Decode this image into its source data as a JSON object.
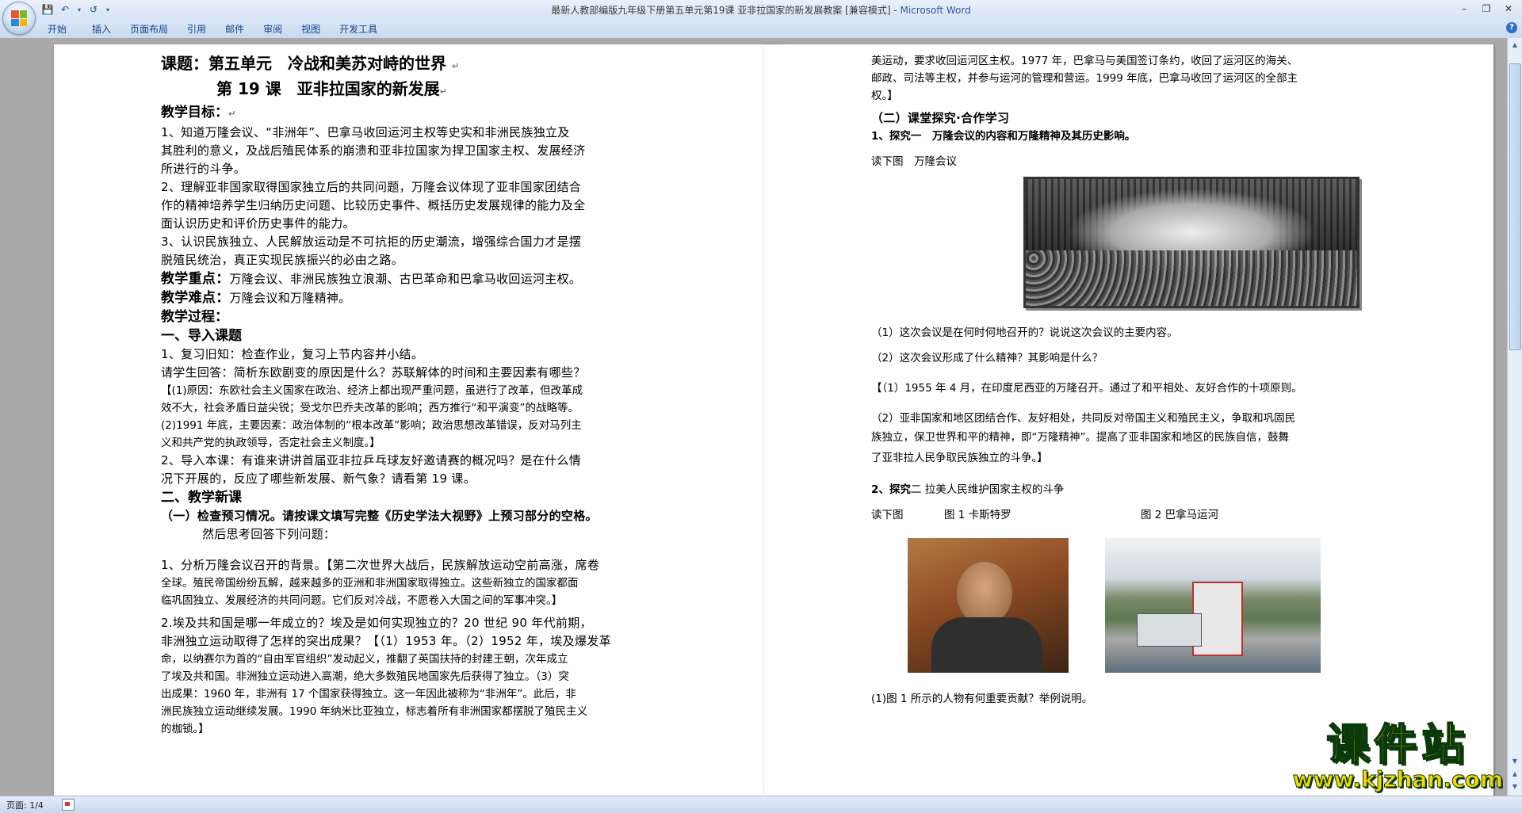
{
  "window": {
    "title": "最新人教部编版九年级下册第五单元第19课 亚非拉国家的新发展教案 [兼容模式] - ",
    "app_name": "Microsoft Word"
  },
  "ribbon": {
    "tabs": [
      "开始",
      "插入",
      "页面布局",
      "引用",
      "邮件",
      "审阅",
      "视图",
      "开发工具"
    ]
  },
  "status": {
    "page_counter": "页面: 1/4"
  },
  "watermark": {
    "title": "课件站",
    "url": "www.kjzhan.com"
  },
  "left_page": {
    "title1": "课题：第五单元　冷战和美苏对峙的世界",
    "title2": "第 19 课　亚非拉国家的新发展",
    "goals_head": "教学目标：",
    "goal1": [
      "1、知道万隆会议、“非洲年”、巴拿马收回运河主权等史实和非洲民族独立及",
      "其胜利的意义，及战后殖民体系的崩溃和亚非拉国家为捍卫国家主权、发展经济",
      "所进行的斗争。"
    ],
    "goal2": [
      "2、理解亚非国家取得国家独立后的共同问题，万隆会议体现了亚非国家团结合",
      "作的精神培养学生归纳历史问题、比较历史事件、概括历史发展规律的能力及全",
      "面认识历史和评价历史事件的能力。"
    ],
    "goal3": [
      "3、认识民族独立、人民解放运动是不可抗拒的历史潮流，增强综合国力才是摆",
      "脱殖民统治，真正实现民族振兴的必由之路。"
    ],
    "key_head": "教学重点：",
    "key_text": "万隆会议、非洲民族独立浪潮、古巴革命和巴拿马收回运河主权。",
    "diff_head": "教学难点：",
    "diff_text": "万隆会议和万隆精神。",
    "process_head": "教学过程：",
    "sec1_head": "一、导入课题",
    "review1": "1、复习旧知：检查作业，复习上节内容并小结。",
    "review2": "请学生回答：简析东欧剧变的原因是什么？苏联解体的时间和主要因素有哪些？",
    "answer_lines": [
      "【(1)原因：东欧社会主义国家在政治、经济上都出现严重问题，虽进行了改革，但改革成",
      "效不大，社会矛盾日益尖锐；受戈尔巴乔夫改革的影响；西方推行“和平演变”的战略等。",
      "(2)1991 年底，主要因素：政治体制的“根本改革”影响；政治思想改革错误，反对马列主",
      "义和共产党的执政领导，否定社会主义制度。】"
    ],
    "intro_lines": [
      "2、导入本课：有谁来讲讲首届亚非拉乒乓球友好邀请赛的概况吗？是在什么情",
      "况下开展的，反应了哪些新发展、新气象？请看第 19 课。"
    ],
    "sec2_head": "二、教学新课",
    "preview_lines": [
      "（一）检查预习情况。请按课文填写完整《历史学法大视野》上预习部分的空格。",
      "然后思考回答下列问题："
    ],
    "q1_lines": [
      "1、分析万隆会议召开的背景。【第二次世界大战后，民族解放运动空前高涨，席卷",
      "全球。殖民帝国纷纷瓦解，越来越多的亚洲和非洲国家取得独立。这些新独立的国家都面",
      "临巩固独立、发展经济的共同问题。它们反对冷战，不愿卷入大国之间的军事冲突。】"
    ],
    "q2_lines": [
      "2.埃及共和国是哪一年成立的？埃及是如何实现独立的？20 世纪 90 年代前期，",
      "非洲独立运动取得了怎样的突出成果？【（1）1953 年。（2）1952 年，埃及爆发革",
      "命，以纳赛尔为首的“自由军官组织”发动起义，推翻了英国扶持的封建王朝，次年成立",
      "了埃及共和国。非洲独立运动进入高潮，绝大多数殖民地国家先后获得了独立。（3）突",
      "出成果：1960 年，非洲有 17 个国家获得独立。这一年因此被称为“非洲年”。此后，非",
      "洲民族独立运动继续发展。1990 年纳米比亚独立，标志着所有非洲国家都摆脱了殖民主义",
      "的枷锁。】"
    ]
  },
  "right_page": {
    "top_lines": [
      "美运动，要求收回运河区主权。1977 年，巴拿马与美国签订条约，收回了运河区的海关、",
      "邮政、司法等主权，并参与运河的管理和营运。1999 年底，巴拿马收回了运河区的全部主",
      "权。】"
    ],
    "explore_head": "（二）课堂探究·合作学习",
    "explore1": "1、探究一　万隆会议的内容和万隆精神及其历史影响。",
    "read_fig1": "读下图　万隆会议",
    "q_a": "（1）这次会议是在何时何地召开的？说说这次会议的主要内容。",
    "q_b": "（2）这次会议形成了什么精神？其影响是什么？",
    "ans_a": "【（1）1955 年 4 月，在印度尼西亚的万隆召开。通过了和平相处、友好合作的十项原则。",
    "ans_b_lines": [
      "（2）亚非国家和地区团结合作、友好相处，共同反对帝国主义和殖民主义，争取和巩固民",
      "族独立，保卫世界和平的精神，即“万隆精神”。提高了亚非国家和地区的民族自信，鼓舞",
      "了亚非拉人民争取民族独立的斗争。】"
    ],
    "explore2_num": "2、探究",
    "explore2_rest": "二 拉美人民维护国家主权的斗争",
    "read_fig2": "读下图",
    "fig1_caption": "图 1 卡斯特罗",
    "fig2_caption": "图 2 巴拿马运河",
    "q_c": "(1)图 1 所示的人物有何重要贡献？举例说明。"
  }
}
